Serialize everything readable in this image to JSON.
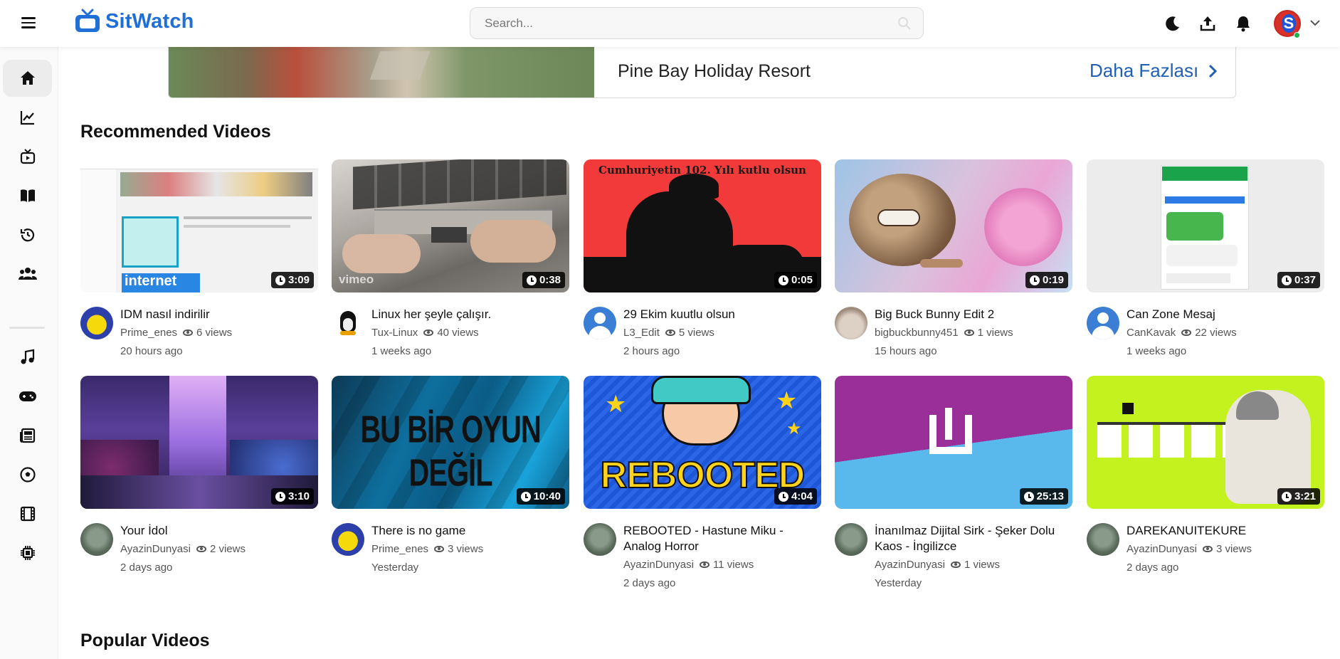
{
  "app": {
    "name": "SitWatch",
    "brand_color": "#1f6fd6"
  },
  "search": {
    "placeholder": "Search..."
  },
  "header_icons": [
    "moon-icon",
    "upload-icon",
    "bell-icon"
  ],
  "user": {
    "initial": "S"
  },
  "sidebar": {
    "items": [
      {
        "icon": "home-icon",
        "active": true
      },
      {
        "icon": "trending-icon"
      },
      {
        "icon": "subscriptions-icon"
      },
      {
        "icon": "library-icon"
      },
      {
        "icon": "history-icon"
      },
      {
        "icon": "community-icon"
      },
      {
        "icon": "music-icon"
      },
      {
        "icon": "gaming-icon"
      },
      {
        "icon": "news-icon"
      },
      {
        "icon": "sports-icon"
      },
      {
        "icon": "movies-icon"
      },
      {
        "icon": "technology-icon"
      }
    ]
  },
  "banner": {
    "title": "Pine Bay Holiday Resort",
    "more_label": "Daha Fazlası"
  },
  "sections": {
    "recommended": "Recommended Videos",
    "popular": "Popular Videos"
  },
  "videos": [
    {
      "title": "IDM nasıl indirilir",
      "channel": "Prime_enes",
      "views": "6 views",
      "time": "20 hours ago",
      "duration": "3:09"
    },
    {
      "title": "Linux her şeyle çalışır.",
      "channel": "Tux-Linux",
      "views": "40 views",
      "time": "1 weeks ago",
      "duration": "0:38"
    },
    {
      "title": "29 Ekim kuutlu olsun",
      "channel": "L3_Edit",
      "views": "5 views",
      "time": "2 hours ago",
      "duration": "0:05"
    },
    {
      "title": "Big Buck Bunny Edit 2",
      "channel": "bigbuckbunny451",
      "views": "1 views",
      "time": "15 hours ago",
      "duration": "0:19"
    },
    {
      "title": "Can Zone Mesaj",
      "channel": "CanKavak",
      "views": "22 views",
      "time": "1 weeks ago",
      "duration": "0:37"
    },
    {
      "title": "Your İdol",
      "channel": "AyazinDunyasi",
      "views": "2 views",
      "time": "2 days ago",
      "duration": "3:10"
    },
    {
      "title": "There is no game",
      "channel": "Prime_enes",
      "views": "3 views",
      "time": "Yesterday",
      "duration": "10:40"
    },
    {
      "title": "REBOOTED - Hastune Miku - Analog Horror",
      "channel": "AyazinDunyasi",
      "views": "11 views",
      "time": "2 days ago",
      "duration": "4:04"
    },
    {
      "title": "İnanılmaz Dijital Sirk - Şeker Dolu Kaos - İngilizce",
      "channel": "AyazinDunyasi",
      "views": "1 views",
      "time": "Yesterday",
      "duration": "25:13"
    },
    {
      "title": "DAREKANUITEKURE",
      "channel": "AyazinDunyasi",
      "views": "3 views",
      "time": "2 days ago",
      "duration": "3:21"
    }
  ],
  "thumb_text": {
    "cumhuriyet": "Cumhuriyetin 102. Yılı kutlu olsun",
    "oyun": "BU BİR OYUN DEĞİL",
    "rebooted": "REBOOTED",
    "vimeo": "vimeo",
    "idm_internet": "internet"
  }
}
